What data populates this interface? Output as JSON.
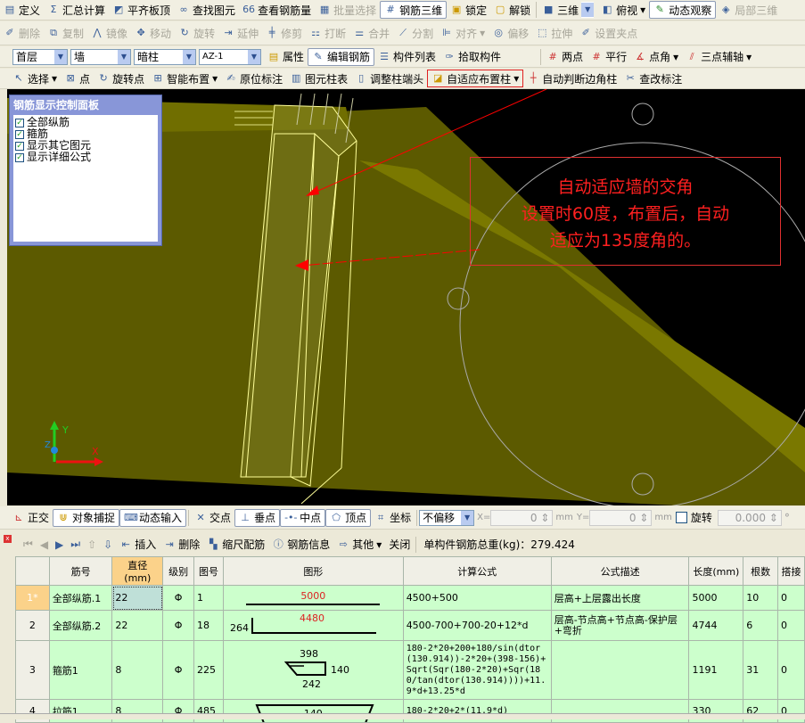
{
  "toolbar1": {
    "items": [
      "定义",
      "汇总计算",
      "平齐板顶",
      "查找图元",
      "查看钢筋量",
      "批量选择",
      "钢筋三维",
      "锁定",
      "解锁",
      "三维",
      "俯视",
      "动态观察",
      "局部三维"
    ]
  },
  "toolbar2": {
    "items": [
      "删除",
      "复制",
      "镜像",
      "移动",
      "旋转",
      "延伸",
      "修剪",
      "打断",
      "合并",
      "分割",
      "对齐",
      "偏移",
      "拉伸",
      "设置夹点"
    ]
  },
  "toolbar3": {
    "floor": "首层",
    "type": "墙",
    "subtype": "暗柱",
    "name": "AZ-1",
    "items": [
      "属性",
      "编辑钢筋",
      "构件列表",
      "拾取构件"
    ],
    "snap": [
      "两点",
      "平行",
      "点角",
      "三点辅轴"
    ]
  },
  "toolbar4": {
    "items": [
      "选择",
      "点",
      "旋转点",
      "智能布置",
      "原位标注",
      "图元柱表",
      "调整柱端头",
      "自适应布置柱",
      "自动判断边角柱",
      "查改标注"
    ]
  },
  "control_panel": {
    "title": "钢筋显示控制面板",
    "options": [
      {
        "label": "全部纵筋",
        "checked": true
      },
      {
        "label": "箍筋",
        "checked": true
      },
      {
        "label": "显示其它图元",
        "checked": true
      },
      {
        "label": "显示详细公式",
        "checked": true
      }
    ]
  },
  "annotation": {
    "lines": [
      "自动适应墙的交角",
      "设置时60度，布置后，自动",
      "适应为135度角的。"
    ]
  },
  "axes": {
    "x": "X",
    "y": "Y",
    "z": "Z"
  },
  "snapbar": {
    "items": [
      "正交",
      "对象捕捉",
      "动态输入",
      "交点",
      "垂点",
      "中点",
      "顶点",
      "坐标"
    ],
    "offset": "不偏移",
    "x_label": "X=",
    "x_value": "0",
    "y_label": "Y=",
    "y_value": "0",
    "unit": "mm",
    "rotate_label": "旋转",
    "rotate_value": "0.000",
    "deg": "°"
  },
  "gridbar": {
    "items": [
      "插入",
      "删除",
      "缩尺配筋",
      "钢筋信息",
      "其他",
      "关闭"
    ],
    "weight_label": "单构件钢筋总重(kg)：279.424"
  },
  "table": {
    "headers": [
      "",
      "筋号",
      "直径(mm)",
      "级别",
      "图号",
      "图形",
      "计算公式",
      "公式描述",
      "长度(mm)",
      "根数",
      "搭接"
    ],
    "rows": [
      {
        "idx": "1*",
        "name": "全部纵筋.1",
        "dia": "22",
        "grade": "Φ",
        "fig": "1",
        "shape_val": "5000",
        "formula": "4500+500",
        "desc": "层高+上层露出长度",
        "len": "5000",
        "count": "10",
        "lap": "0"
      },
      {
        "idx": "2",
        "name": "全部纵筋.2",
        "dia": "22",
        "grade": "Φ",
        "fig": "18",
        "shape_left": "264",
        "shape_val": "4480",
        "formula": "4500-700+700-20+12*d",
        "desc": "层高-节点高+节点高-保护层+弯折",
        "len": "4744",
        "count": "6",
        "lap": "0"
      },
      {
        "idx": "3",
        "name": "箍筋1",
        "dia": "8",
        "grade": "Φ",
        "fig": "225",
        "shape_top": "398",
        "shape_right": "140",
        "shape_bottom": "242",
        "formula": "180-2*20+200+180/sin(dtor(130.914))-2*20+(398-156)+Sqrt(Sqr(180-2*20)+Sqr(180/tan(dtor(130.914))))+11.9*d+13.25*d",
        "desc": "",
        "len": "1191",
        "count": "31",
        "lap": "0"
      },
      {
        "idx": "4",
        "name": "拉筋1",
        "dia": "8",
        "grade": "Φ",
        "fig": "485",
        "shape_val": "140",
        "formula": "180-2*20+2*(11.9*d)",
        "desc": "",
        "len": "330",
        "count": "62",
        "lap": "0"
      }
    ]
  }
}
